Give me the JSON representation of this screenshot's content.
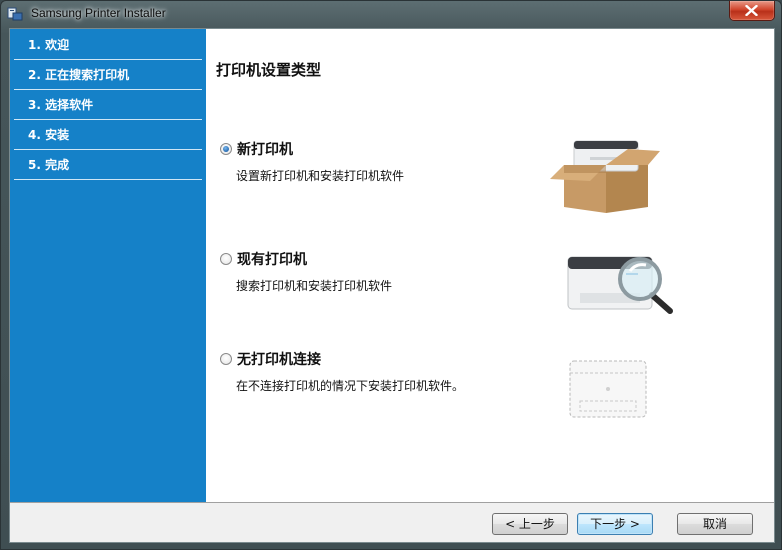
{
  "window": {
    "title": "Samsung Printer Installer"
  },
  "sidebar": {
    "steps": [
      {
        "label": "1. 欢迎"
      },
      {
        "label": "2. 正在搜索打印机"
      },
      {
        "label": "3. 选择软件"
      },
      {
        "label": "4. 安装"
      },
      {
        "label": "5. 完成"
      }
    ]
  },
  "main": {
    "heading": "打印机设置类型",
    "options": [
      {
        "label": "新打印机",
        "description": "设置新打印机和安装打印机软件",
        "selected": true,
        "icon": "printer-in-box-icon"
      },
      {
        "label": "现有打印机",
        "description": "搜索打印机和安装打印机软件",
        "selected": false,
        "icon": "printer-magnifier-icon"
      },
      {
        "label": "无打印机连接",
        "description": "在不连接打印机的情况下安装打印机软件。",
        "selected": false,
        "icon": "printer-outline-icon"
      }
    ]
  },
  "footer": {
    "back_label": "< 上一步",
    "next_label": "下一步 >",
    "cancel_label": "取消"
  },
  "colors": {
    "sidebar": "#1581c8",
    "close_button": "#c9452c"
  }
}
